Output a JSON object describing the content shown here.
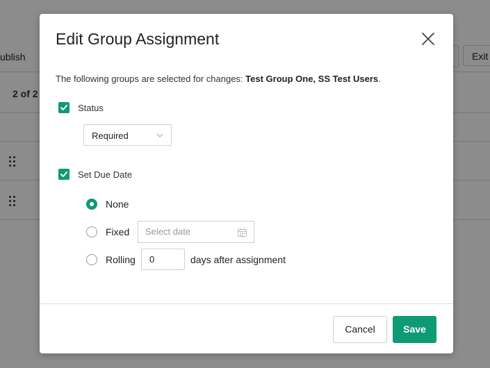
{
  "background": {
    "publish_label": "ublish",
    "exit_label": "Exit",
    "count_label": "2 of 2"
  },
  "modal": {
    "title": "Edit Group Assignment",
    "description_prefix": "The following groups are selected for changes: ",
    "description_groups": "Test Group One, SS Test Users",
    "description_suffix": ".",
    "status": {
      "label": "Status",
      "checked": true,
      "selected_value": "Required"
    },
    "due_date": {
      "label": "Set Due Date",
      "checked": true,
      "options": [
        {
          "label": "None",
          "selected": true
        },
        {
          "label": "Fixed",
          "selected": false
        },
        {
          "label": "Rolling",
          "selected": false
        }
      ],
      "fixed_placeholder": "Select date",
      "rolling_value": "0",
      "rolling_suffix": "days after assignment"
    },
    "buttons": {
      "cancel": "Cancel",
      "save": "Save"
    }
  },
  "colors": {
    "accent": "#0f9a76",
    "overlay": "rgba(0,0,0,0.45)"
  }
}
